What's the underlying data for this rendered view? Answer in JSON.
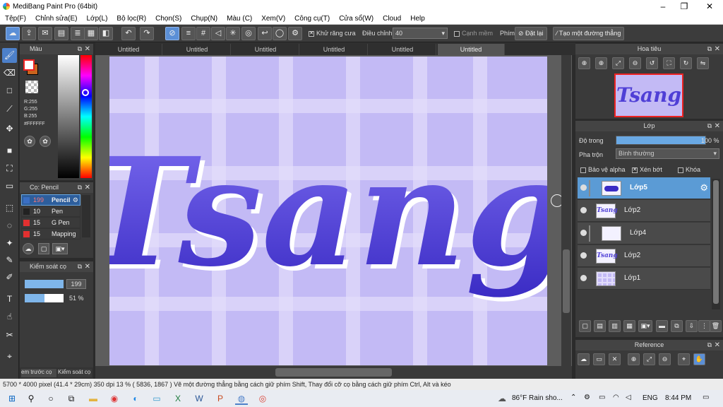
{
  "window": {
    "title": "MediBang Paint Pro (64bit)",
    "controls": [
      "–",
      "❐",
      "✕"
    ]
  },
  "menu": [
    "Tệp(F)",
    "Chỉnh sửa(E)",
    "Lớp(L)",
    "Bộ lọc(R)",
    "Chọn(S)",
    "Chụp(N)",
    "Màu (C)",
    "Xem(V)",
    "Công cụ(T)",
    "Cửa sổ(W)",
    "Cloud",
    "Help"
  ],
  "toolbar": {
    "antialias_label": "Khử răng cưa",
    "adjust_label": "Điều chỉnh",
    "adjust_value": "40",
    "edge_label": "Cạnh mềm",
    "key_label": "Phím",
    "reset_label": "Đặt lại",
    "create_line_label": "Tạo một đường thẳng"
  },
  "color_panel": {
    "title": "Màu",
    "r": "R:255",
    "g": "G:255",
    "b": "B:255",
    "hex": "#FFFFFF",
    "primary_color": "#ffffff",
    "secondary_color": "#c8641e"
  },
  "brush_panel": {
    "title": "Cọ: Pencil",
    "brushes": [
      {
        "size": "199",
        "name": "Pencil",
        "color": "#3a6fc4",
        "active": true
      },
      {
        "size": "10",
        "name": "Pen",
        "color": "#222222",
        "active": false
      },
      {
        "size": "15",
        "name": "G Pen",
        "color": "#e23030",
        "active": false
      },
      {
        "size": "15",
        "name": "Mapping",
        "color": "#e23030",
        "active": false
      }
    ]
  },
  "brush_control": {
    "title": "Kiểm soát cọ",
    "size_value": "199",
    "size_fraction": 1.0,
    "opacity_value": "51 %",
    "opacity_fraction": 0.51
  },
  "left_bottom_tabs": [
    "em trước cọ",
    "Kiểm soát cọ"
  ],
  "document_tabs": [
    "Untitled",
    "Untitled",
    "Untitled",
    "Untitled",
    "Untitled",
    "Untitled"
  ],
  "active_tab_index": 5,
  "artwork": {
    "text": "Tsang",
    "bg_color": "#c3baf5",
    "text_color": "#4f3fd6"
  },
  "navigator": {
    "title": "Hoa tiêu",
    "thumb_text": "Tsang"
  },
  "layer_panel": {
    "title": "Lớp",
    "opacity_label": "Độ trong",
    "opacity_value": "100 %",
    "opacity_fraction": 1.0,
    "blend_label": "Pha trộn",
    "blend_value": "Bình thường",
    "protect_alpha": "Bảo vệ alpha",
    "clip": "Xén bớt",
    "lock": "Khóa",
    "layers": [
      {
        "name": "Lớp5",
        "active": true,
        "thumb": "stroke"
      },
      {
        "name": "Lớp2",
        "active": false,
        "thumb": "text"
      },
      {
        "name": "Lớp4",
        "active": false,
        "thumb": "blank"
      },
      {
        "name": "Lớp2",
        "active": false,
        "thumb": "text"
      },
      {
        "name": "Lớp1",
        "active": false,
        "thumb": "grid"
      }
    ]
  },
  "reference_panel": {
    "title": "Reference"
  },
  "status": {
    "text": "5700 * 4000 pixel  (41.4 * 29cm)  350 dpi  13 %  ( 5836, 1867 )  Vẽ một đường thẳng bằng cách giữ phím Shift, Thay đổi cỡ cọ bằng cách giữ phím Ctrl, Alt và kéo"
  },
  "taskbar": {
    "weather": "86°F  Rain sho...",
    "lang": "ENG",
    "time": "8:44 PM"
  }
}
